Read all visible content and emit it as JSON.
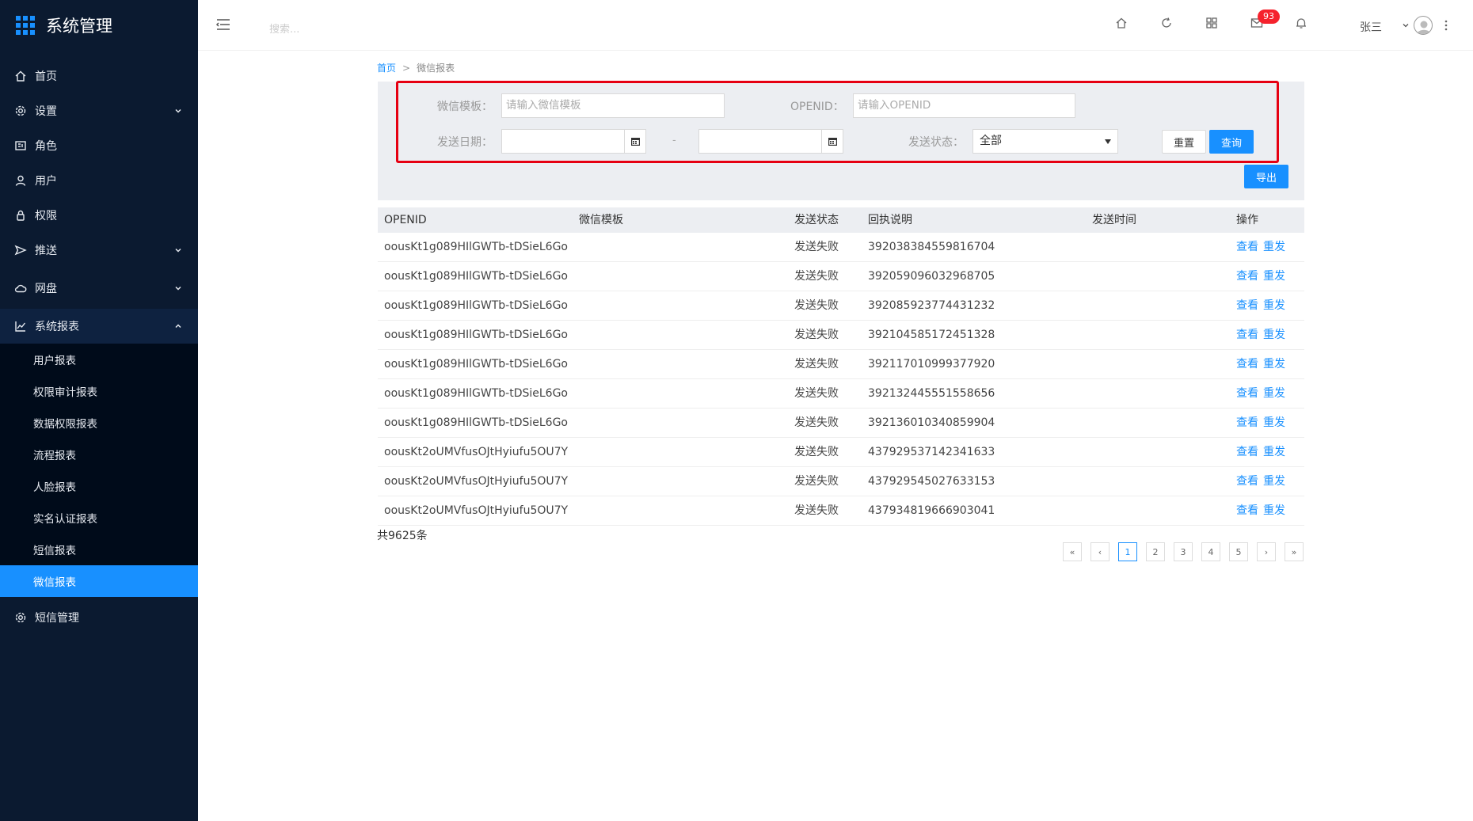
{
  "app": {
    "title": "系统管理"
  },
  "sidebar": {
    "items": [
      {
        "label": "首页",
        "icon": "home-icon"
      },
      {
        "label": "设置",
        "icon": "gear-icon"
      },
      {
        "label": "角色",
        "icon": "role-icon"
      },
      {
        "label": "用户",
        "icon": "user-icon"
      },
      {
        "label": "权限",
        "icon": "lock-icon"
      },
      {
        "label": "推送",
        "icon": "send-icon"
      },
      {
        "label": "网盘",
        "icon": "cloud-icon"
      },
      {
        "label": "系统报表",
        "icon": "chart-icon"
      },
      {
        "label": "短信管理",
        "icon": "gear-icon"
      }
    ],
    "reports": [
      {
        "label": "用户报表"
      },
      {
        "label": "权限审计报表"
      },
      {
        "label": "数据权限报表"
      },
      {
        "label": "流程报表"
      },
      {
        "label": "人脸报表"
      },
      {
        "label": "实名认证报表"
      },
      {
        "label": "短信报表"
      },
      {
        "label": "微信报表"
      }
    ]
  },
  "topbar": {
    "search_placeholder": "搜索...",
    "mail_badge": "93",
    "username": "张三"
  },
  "breadcrumb": {
    "home": "首页",
    "separator": ">",
    "current": "微信报表"
  },
  "filter": {
    "template_label": "微信模板：",
    "template_placeholder": "请输入微信模板",
    "openid_label": "OPENID：",
    "openid_placeholder": "请输入OPENID",
    "date_label": "发送日期：",
    "date_dash": "-",
    "status_label": "发送状态：",
    "status_value": "全部",
    "reset": "重置",
    "query": "查询",
    "export": "导出"
  },
  "table": {
    "headers": [
      "OPENID",
      "微信模板",
      "发送状态",
      "回执说明",
      "发送时间",
      "操作"
    ],
    "action_view": "查看",
    "action_resend": "重发",
    "rows": [
      {
        "openid": "oousKt1g089HIlGWTb-tDSieL6Go",
        "template": "",
        "status": "发送失败",
        "receipt": "392038384559816704",
        "time": ""
      },
      {
        "openid": "oousKt1g089HIlGWTb-tDSieL6Go",
        "template": "",
        "status": "发送失败",
        "receipt": "392059096032968705",
        "time": ""
      },
      {
        "openid": "oousKt1g089HIlGWTb-tDSieL6Go",
        "template": "",
        "status": "发送失败",
        "receipt": "392085923774431232",
        "time": ""
      },
      {
        "openid": "oousKt1g089HIlGWTb-tDSieL6Go",
        "template": "",
        "status": "发送失败",
        "receipt": "392104585172451328",
        "time": ""
      },
      {
        "openid": "oousKt1g089HIlGWTb-tDSieL6Go",
        "template": "",
        "status": "发送失败",
        "receipt": "392117010999377920",
        "time": ""
      },
      {
        "openid": "oousKt1g089HIlGWTb-tDSieL6Go",
        "template": "",
        "status": "发送失败",
        "receipt": "392132445551558656",
        "time": ""
      },
      {
        "openid": "oousKt1g089HIlGWTb-tDSieL6Go",
        "template": "",
        "status": "发送失败",
        "receipt": "392136010340859904",
        "time": ""
      },
      {
        "openid": "oousKt2oUMVfusOJtHyiufu5OU7Y",
        "template": "",
        "status": "发送失败",
        "receipt": "437929537142341633",
        "time": ""
      },
      {
        "openid": "oousKt2oUMVfusOJtHyiufu5OU7Y",
        "template": "",
        "status": "发送失败",
        "receipt": "437929545027633153",
        "time": ""
      },
      {
        "openid": "oousKt2oUMVfusOJtHyiufu5OU7Y",
        "template": "",
        "status": "发送失败",
        "receipt": "437934819666903041",
        "time": ""
      }
    ]
  },
  "pagination": {
    "total": "共9625条",
    "first": "«",
    "prev": "‹",
    "pages": [
      "1",
      "2",
      "3",
      "4",
      "5"
    ],
    "current": "1",
    "next": "›",
    "last": "»"
  },
  "colors": {
    "accent": "#1890ff",
    "sidebar_bg": "#0b1a30",
    "highlight_border": "#e60012",
    "badge": "#f5222d"
  }
}
